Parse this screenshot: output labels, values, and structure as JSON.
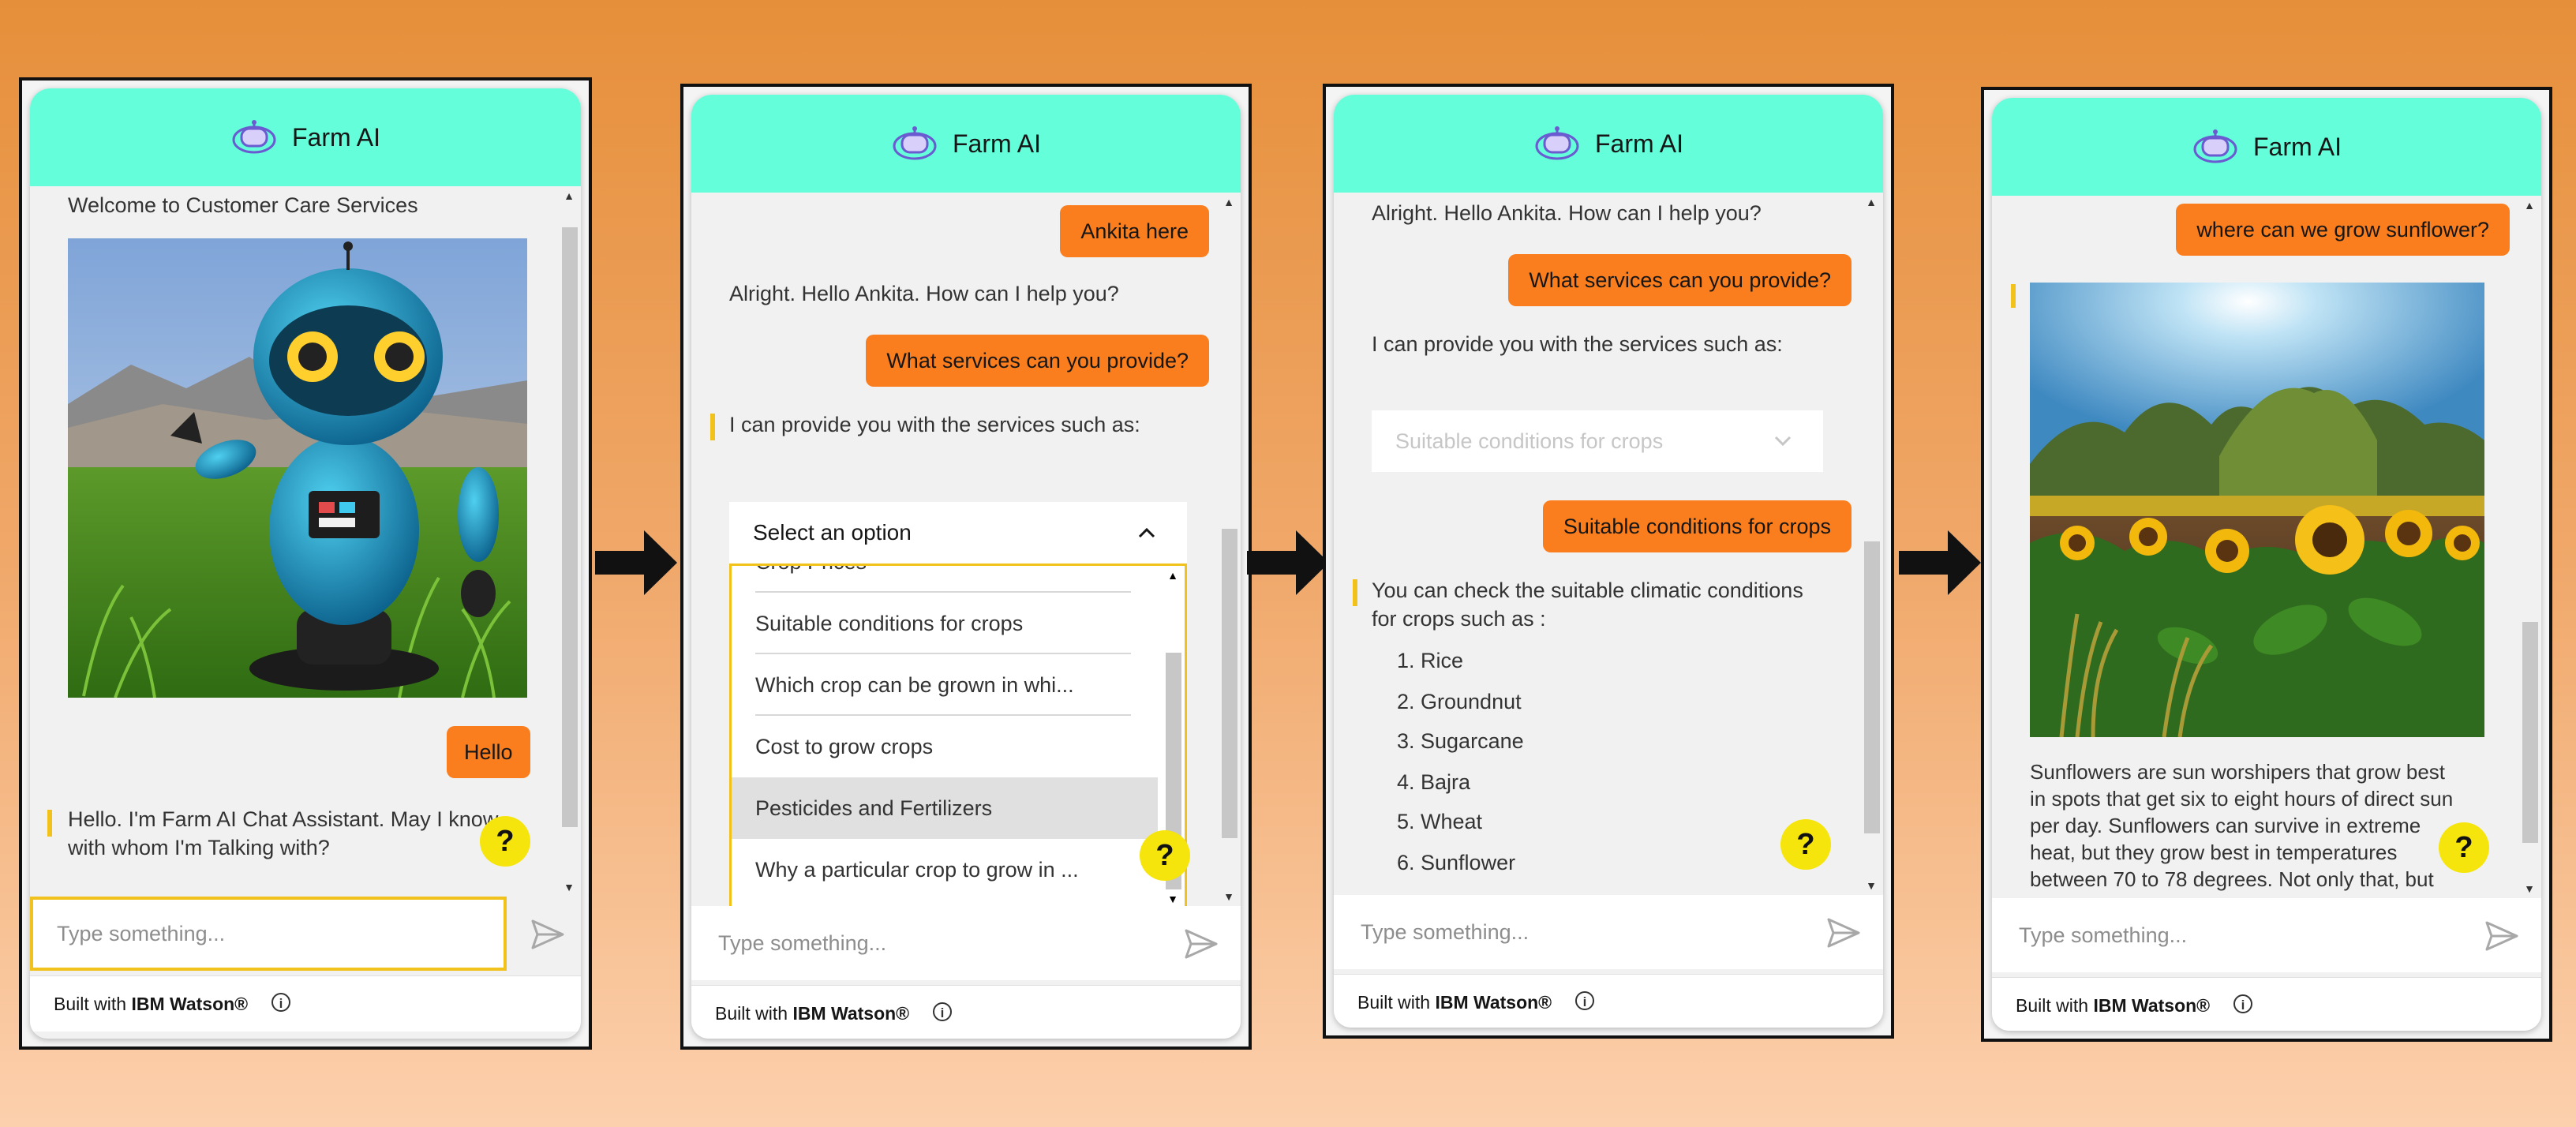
{
  "app": {
    "title": "Farm AI",
    "input_placeholder": "Type something...",
    "footer_prefix": "Built with ",
    "footer_brand": "IBM Watson®",
    "help_symbol": "?"
  },
  "panel1": {
    "welcome": "Welcome to Customer Care Services",
    "user_hello": "Hello",
    "bot_greeting": "Hello. I'm Farm AI Chat Assistant. May I know with whom I'm Talking with?"
  },
  "panel2": {
    "user_name": "Ankita here",
    "bot_hello": "Alright. Hello Ankita. How can I help you?",
    "user_question": "What services can you provide?",
    "bot_services": "I can provide you with the services such as:",
    "select_label": "Select an option",
    "options": [
      "Crop Prices",
      "Suitable conditions for crops",
      "Which crop can be grown in whi...",
      "Cost to grow crops",
      "Pesticides and Fertilizers",
      "Why a particular crop to grow in ..."
    ]
  },
  "panel3": {
    "bot_hello": "Alright. Hello Ankita. How can I help you?",
    "user_question": "What services can you provide?",
    "bot_services": "I can provide you with the services such as:",
    "selected_option": "Suitable conditions for crops",
    "user_choice": "Suitable conditions for crops",
    "bot_conditions_line1": "You can check the suitable climatic conditions",
    "bot_conditions_line2": "for crops such as :",
    "crops": [
      "1. Rice",
      "2. Groundnut",
      "3. Sugarcane",
      "4. Bajra",
      "5. Wheat",
      "6. Sunflower"
    ]
  },
  "panel4": {
    "user_question": "where can we grow sunflower?",
    "bot_answer_lines": [
      "Sunflowers are sun worshipers that grow best",
      "in spots that get six to eight hours of direct sun",
      "per day. Sunflowers can survive in extreme",
      "heat, but they grow best in temperatures",
      "between 70 to 78 degrees. Not only that, but"
    ]
  },
  "colors": {
    "header": "#64ffda",
    "user_bubble": "#fa7d1e",
    "help_button": "#f5e50d",
    "accent": "#f1c21b"
  }
}
